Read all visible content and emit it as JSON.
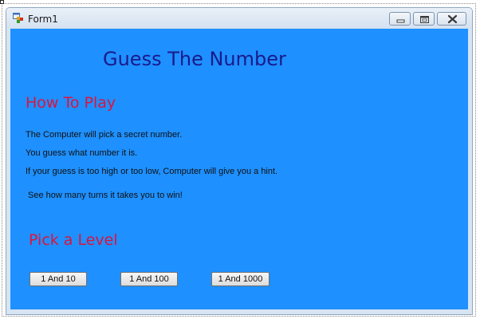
{
  "window": {
    "title": "Form1",
    "icon": "winforms-app-icon",
    "controls": [
      "minimize-icon",
      "maximize-icon",
      "close-icon"
    ]
  },
  "content": {
    "heading": "Guess The Number",
    "how_to_play_title": "How To Play",
    "instructions": [
      "The Computer will pick a secret number.",
      "You guess what number it is.",
      "If your guess is too high or too low, Computer will give you a hint.",
      "See how many turns it takes you to win!"
    ],
    "pick_level_title": "Pick a Level",
    "level_buttons": [
      "1 And 10",
      "1 And 100",
      "1 And 1000"
    ]
  },
  "colors": {
    "client_background": "#1E90FF",
    "heading": "#1A1A8C",
    "subheading": "#DC143C",
    "text": "#111111"
  }
}
